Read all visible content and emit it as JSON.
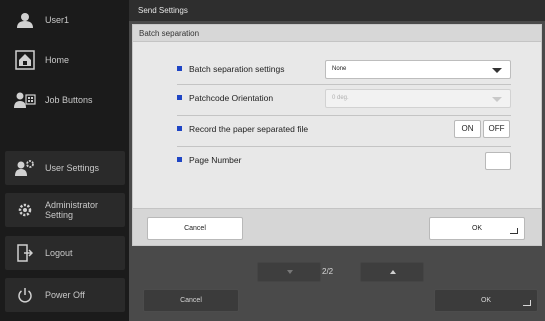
{
  "sidebar": {
    "user": "User1",
    "home": "Home",
    "job_buttons": "Job Buttons",
    "user_settings": "User Settings",
    "administrator_line1": "Administrator",
    "administrator_line2": "Setting",
    "logout": "Logout",
    "power_off": "Power Off"
  },
  "header": {
    "title": "Send Settings"
  },
  "panel": {
    "title": "Batch separation",
    "rows": [
      {
        "label": "Batch separation settings",
        "value": "None"
      },
      {
        "label": "Patchcode Orientation",
        "value": "0 deg."
      },
      {
        "label": "Record the paper separated file",
        "on": "ON",
        "off": "OFF"
      },
      {
        "label": "Page Number"
      }
    ],
    "cancel": "Cancel",
    "ok": "OK"
  },
  "pager": {
    "text": "2/2"
  },
  "bottom": {
    "cancel": "Cancel",
    "ok": "OK"
  },
  "colors": {
    "bullet": "#1f45c4",
    "sidebar_bg": "#1b1b1b",
    "main_bg": "#4a4a4a"
  }
}
